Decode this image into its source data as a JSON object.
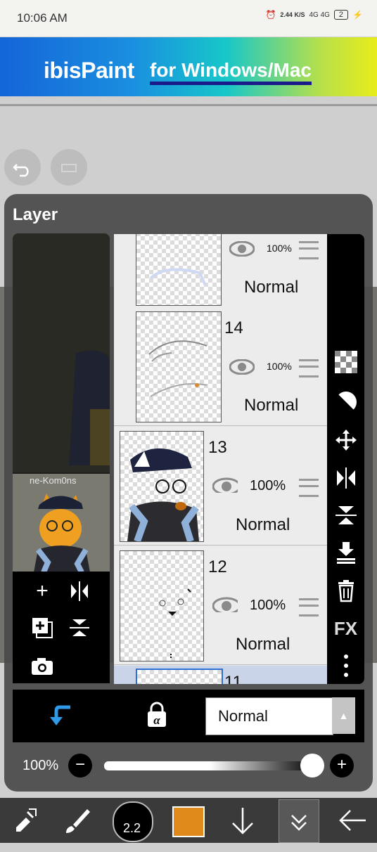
{
  "status_bar": {
    "time": "10:06 AM",
    "speed": "2.44 K/S",
    "network": "4G 4G",
    "battery": "2"
  },
  "banner": {
    "brand": "ibisPaint",
    "tagline": "for Windows/Mac"
  },
  "panel": {
    "title": "Layer"
  },
  "layers": [
    {
      "number": "",
      "opacity": "100%",
      "blend": "Normal"
    },
    {
      "number": "14",
      "opacity": "100%",
      "blend": "Normal"
    },
    {
      "number": "13",
      "opacity": "100%",
      "blend": "Normal"
    },
    {
      "number": "12",
      "opacity": "100%",
      "blend": "Normal"
    },
    {
      "number": "11",
      "opacity": "",
      "blend": ""
    }
  ],
  "preview_art_text": "ne-Kom0ns",
  "right_tools": {
    "fx_label": "FX"
  },
  "mode_bar": {
    "blend_mode": "Normal"
  },
  "opacity_slider": {
    "label": "100%",
    "value": 1.0
  },
  "toolbar": {
    "brush_size": "2.2",
    "color": "#e08a1c"
  },
  "colors": {
    "accent": "#2f9be8",
    "panel_bg": "#4a4a4a"
  }
}
